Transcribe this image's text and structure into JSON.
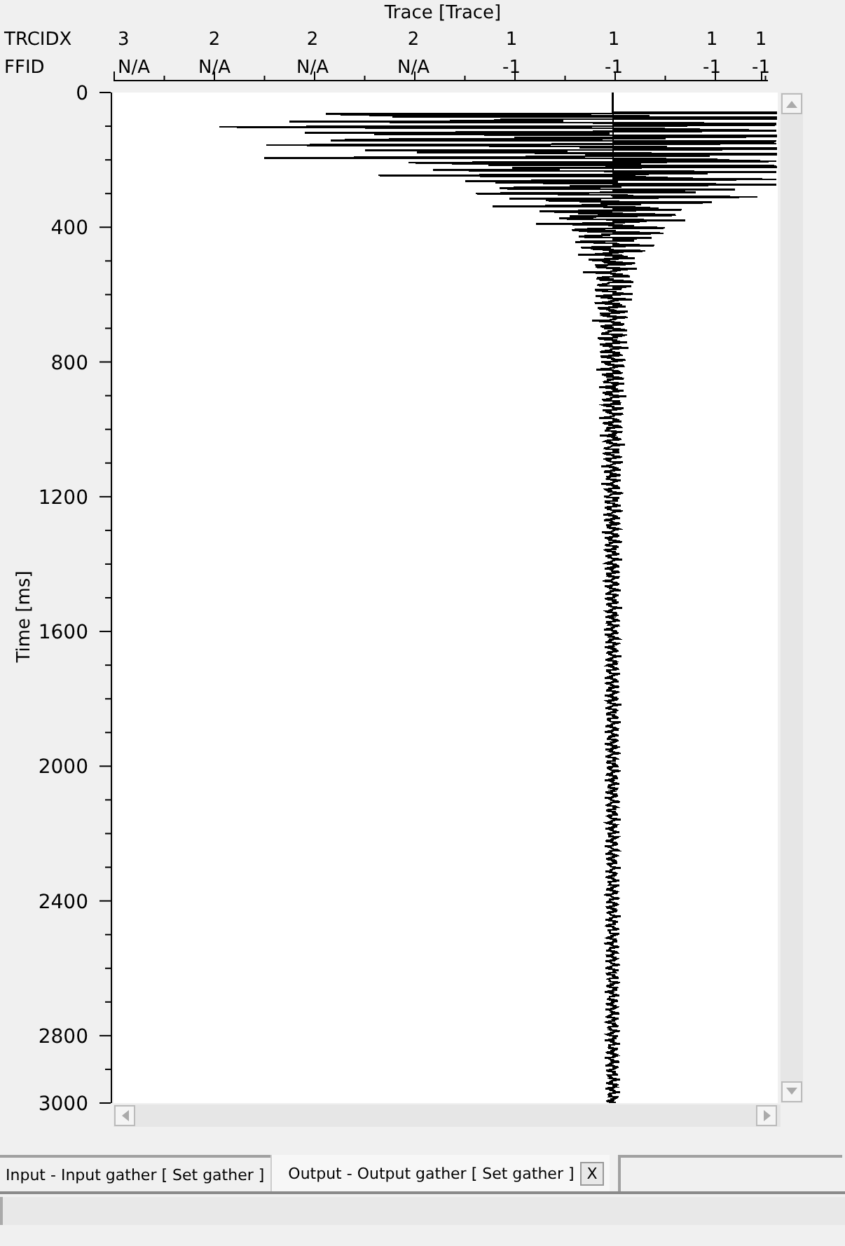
{
  "x_axis": {
    "title": "Trace [Trace]",
    "header_rows": [
      {
        "label": "TRCIDX",
        "values": [
          "3",
          "2",
          "2",
          "2",
          "1",
          "1",
          "1",
          "1"
        ]
      },
      {
        "label": "FFID",
        "values": [
          "N/A",
          "N/A",
          "N/A",
          "N/A",
          "-1",
          "-1",
          "-1",
          "-1"
        ]
      }
    ]
  },
  "y_axis": {
    "title": "Time [ms]",
    "ticks": [
      "0",
      "400",
      "800",
      "1200",
      "1600",
      "2000",
      "2400",
      "2800",
      "3000"
    ]
  },
  "tabs": [
    {
      "label": "Input - Input gather [ Set gather ]",
      "selected": false,
      "closable": false
    },
    {
      "label": "Output - Output gather [ Set gather ]",
      "selected": true,
      "closable": true,
      "close_label": "X"
    }
  ]
}
